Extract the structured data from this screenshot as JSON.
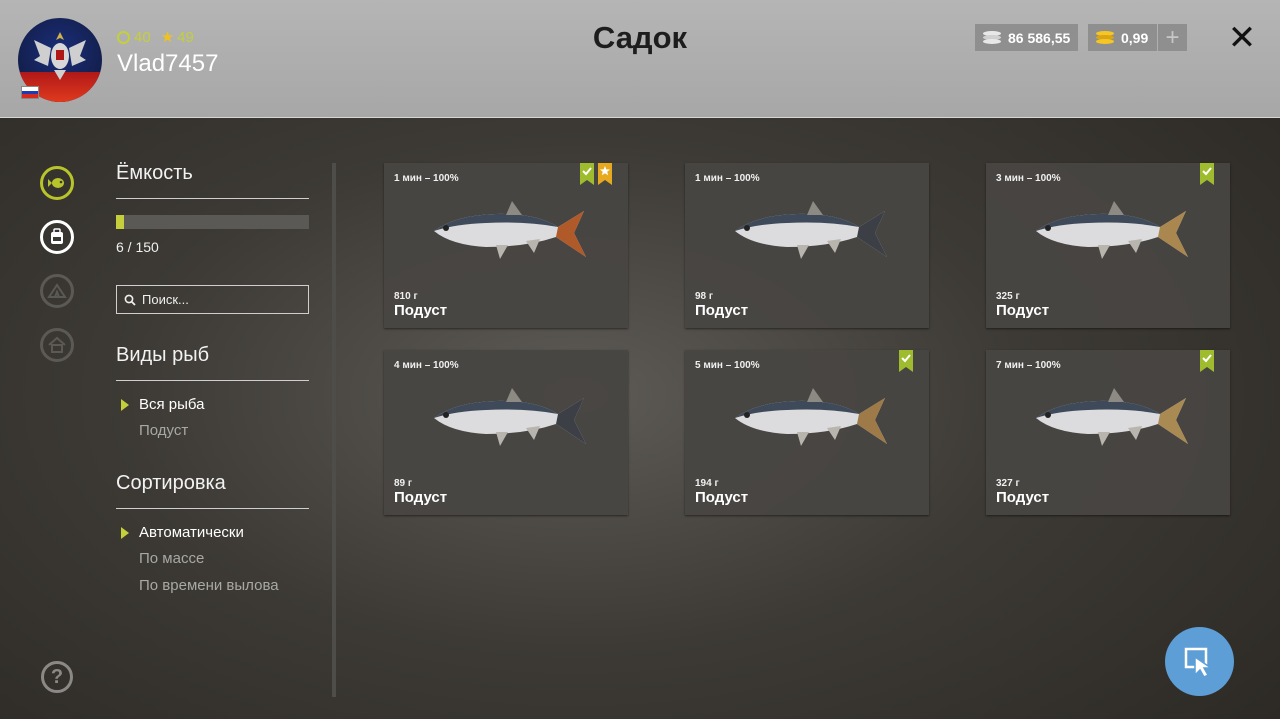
{
  "header": {
    "level": "40",
    "stars": "49",
    "username": "Vlad7457",
    "title": "Садок",
    "silver": "86 586,55",
    "gold": "0,99",
    "add_label": "+",
    "close_label": "✕"
  },
  "capacity": {
    "title": "Ёмкость",
    "text": "6 / 150",
    "fraction": 0.04
  },
  "search": {
    "placeholder": "Поиск..."
  },
  "species": {
    "title": "Виды рыб",
    "items": [
      "Вся рыба",
      "Подуст"
    ]
  },
  "sort": {
    "title": "Сортировка",
    "items": [
      "Автоматически",
      "По массе",
      "По времени вылова"
    ]
  },
  "help_label": "?",
  "catch": [
    {
      "time": "1 мин – 100%",
      "weight": "810 г",
      "name": "Подуст"
    },
    {
      "time": "1 мин – 100%",
      "weight": "98 г",
      "name": "Подуст"
    },
    {
      "time": "3 мин – 100%",
      "weight": "325 г",
      "name": "Подуст"
    },
    {
      "time": "4 мин – 100%",
      "weight": "89 г",
      "name": "Подуст"
    },
    {
      "time": "5 мин – 100%",
      "weight": "194 г",
      "name": "Подуст"
    },
    {
      "time": "7 мин – 100%",
      "weight": "327 г",
      "name": "Подуст"
    }
  ],
  "colors": {
    "accent": "#c4cf3b",
    "star": "#f0c21d",
    "cursor_button": "#5d9ed6"
  }
}
